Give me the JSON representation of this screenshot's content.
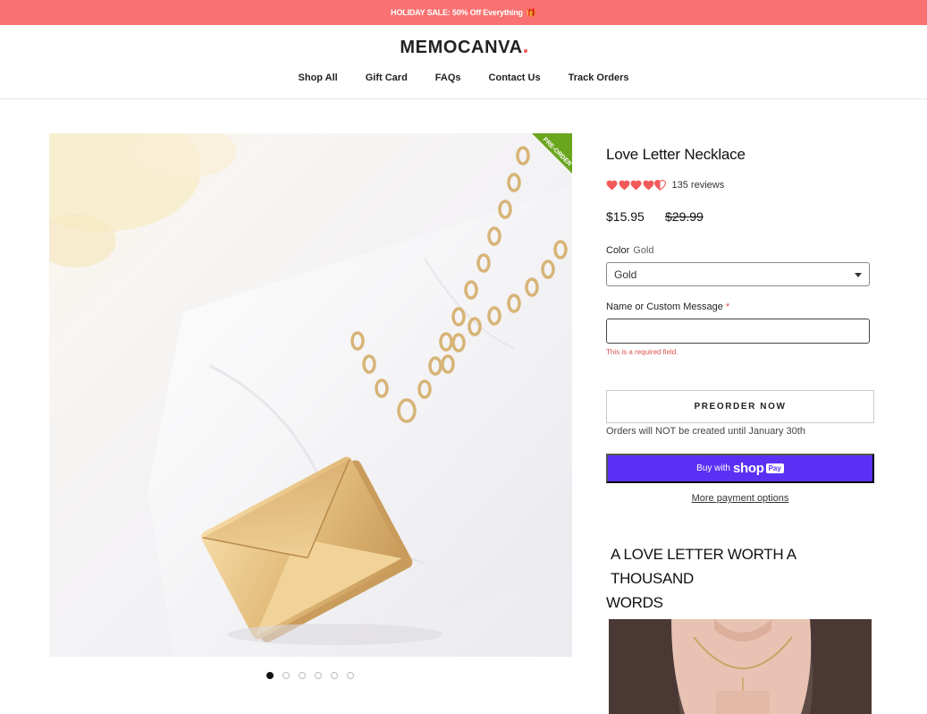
{
  "announcement": {
    "text": "HOLIDAY SALE: 50% Off Everything",
    "gift": "🎁"
  },
  "header": {
    "logo": "MEMOCANVA",
    "nav": [
      "Shop All",
      "Gift Card",
      "FAQs",
      "Contact Us",
      "Track Orders"
    ]
  },
  "gallery": {
    "badge": "PRE-ORDER",
    "dot_count": 6,
    "active_index": 0
  },
  "product": {
    "title": "Love Letter Necklace",
    "rating": 4.5,
    "review_text": "135 reviews",
    "price": "$15.95",
    "compare_price": "$29.99",
    "color_label": "Color",
    "color_value": "Gold",
    "color_selected": "Gold",
    "message_label": "Name or Custom Message",
    "message_required": "*",
    "message_value": "",
    "message_error": "This is a required field.",
    "preorder_label": "PREORDER NOW",
    "orders_note": "Orders will NOT be created until January 30th",
    "shoppay": {
      "buy": "Buy with",
      "shop": "shop",
      "pay": "Pay"
    },
    "more_payment": "More payment options",
    "section_heading_line1": "A LOVE LETTER WORTH A THOUSAND",
    "section_heading_line2": "WORDS"
  },
  "colors": {
    "accent": "#f97171",
    "shoppay": "#5a31f4",
    "heart": "#f25a5a",
    "gold": "#d8b070"
  }
}
